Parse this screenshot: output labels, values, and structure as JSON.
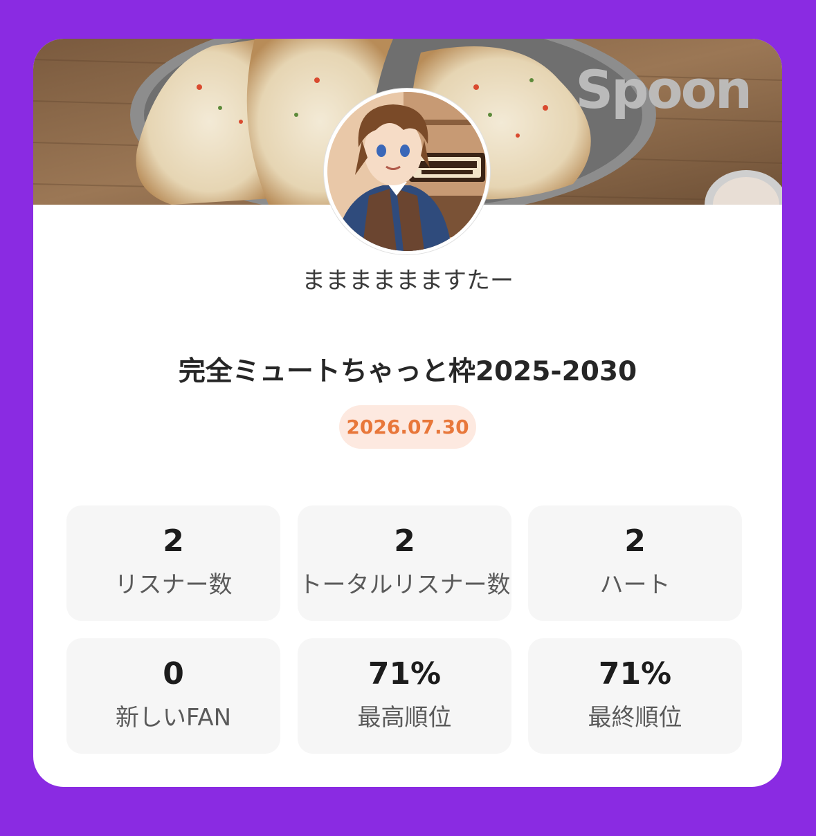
{
  "brand": "Spoon",
  "profile": {
    "username": "まままままますたー"
  },
  "room": {
    "title": "完全ミュートちゃっと枠2025-2030",
    "date": "2026.07.30"
  },
  "stats": [
    {
      "value": "2",
      "label": "リスナー数"
    },
    {
      "value": "2",
      "label": "トータルリスナー数"
    },
    {
      "value": "2",
      "label": "ハート"
    },
    {
      "value": "0",
      "label": "新しいFAN"
    },
    {
      "value": "71%",
      "label": "最高順位"
    },
    {
      "value": "71%",
      "label": "最終順位"
    }
  ],
  "colors": {
    "background": "#8a2be2",
    "card": "#ffffff",
    "date_text": "#e8773a",
    "date_badge": "#fde9e0",
    "stat_box": "#f6f6f6"
  }
}
